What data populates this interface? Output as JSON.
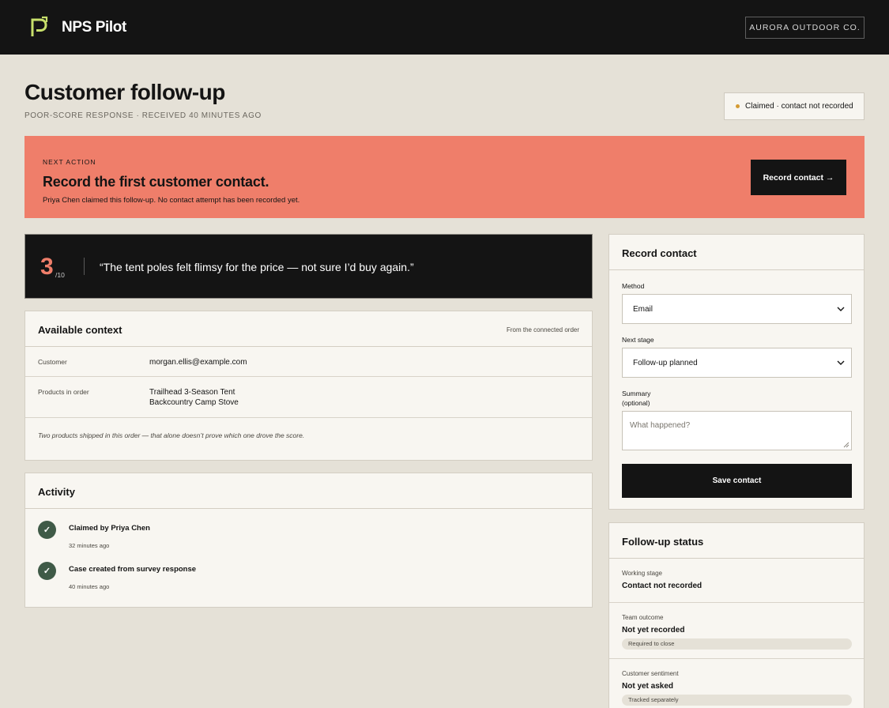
{
  "app": {
    "name": "NPS Pilot",
    "org": "AURORA OUTDOOR CO.",
    "logo_icon": "p-arrow-logo-icon",
    "accent_color": "#c8e06b"
  },
  "header": {
    "title": "Customer follow-up",
    "subtitle": "POOR-SCORE RESPONSE · RECEIVED 40 MINUTES AGO",
    "status": "Claimed · contact not recorded",
    "status_color": "#d49a32"
  },
  "banner": {
    "eyebrow": "NEXT ACTION",
    "title": "Record the first customer contact.",
    "description": "Priya Chen claimed this follow-up. No contact attempt has been recorded yet.",
    "button": "Record contact →",
    "color": "#ef7e6a"
  },
  "response": {
    "score": "3",
    "score_of": "/10",
    "quote": "“The tent poles felt flimsy for the price — not sure I’d buy again.”"
  },
  "context": {
    "title": "Available context",
    "note": "From the connected order",
    "rows": [
      {
        "label": "Customer",
        "lines": [
          "morgan.ellis@example.com"
        ]
      },
      {
        "label": "Products in order",
        "lines": [
          "Trailhead 3-Season Tent",
          "Backcountry Camp Stove"
        ]
      }
    ],
    "footnote": "Two products shipped in this order — that alone doesn’t prove which one drove the score."
  },
  "activity": {
    "title": "Activity",
    "items": [
      {
        "title": "Claimed by Priya Chen",
        "time": "32 minutes ago"
      },
      {
        "title": "Case created from survey response",
        "time": "40 minutes ago"
      }
    ]
  },
  "record_form": {
    "title": "Record contact",
    "method_label": "Method",
    "method_value": "Email",
    "stage_label": "Next stage",
    "stage_value": "Follow-up planned",
    "summary_label": "Summary",
    "summary_hint": "(optional)",
    "summary_placeholder": "What happened?",
    "save_button": "Save contact"
  },
  "followup_status": {
    "title": "Follow-up status",
    "rows": [
      {
        "label": "Working stage",
        "value": "Contact not recorded",
        "pill": ""
      },
      {
        "label": "Team outcome",
        "value": "Not yet recorded",
        "pill": "Required to close"
      },
      {
        "label": "Customer sentiment",
        "value": "Not yet asked",
        "pill": "Tracked separately"
      }
    ]
  }
}
